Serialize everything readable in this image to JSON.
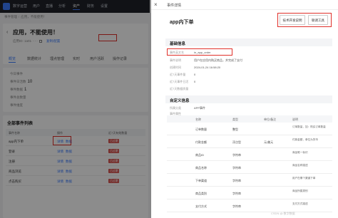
{
  "nav": {
    "items": [
      "数字运营",
      "用户",
      "直播",
      "分析",
      "资产",
      "财务",
      "设置"
    ],
    "active_index": 4
  },
  "breadcrumb": {
    "parent": "事件管理",
    "current": "应用，不能使用！"
  },
  "header": {
    "title": "应用，不能使用！",
    "id_label": "应用ID: 1a01······",
    "id_link": "复制/配置",
    "tabs": [
      "概览",
      "数据统计",
      "埋点管理",
      "实时",
      "用户活跃",
      "操作记录"
    ],
    "active_tab": 0
  },
  "stats": [
    {
      "label": "今日事件",
      "value": ""
    },
    {
      "label": "事件日活数",
      "value": "10"
    },
    {
      "label": "事件数据",
      "value": "1"
    },
    {
      "label": "事件总数量",
      "value": ""
    },
    {
      "label": "事件维度",
      "value": ""
    }
  ],
  "event_list": {
    "title": "全部事件列表",
    "columns": [
      "事件名称",
      "操作",
      "近7天有效数量"
    ],
    "rows": [
      {
        "name": "app内下单",
        "actions": [
          "详情",
          "数据"
        ],
        "badge": "已过期"
      },
      {
        "name": "登录",
        "actions": [
          "详情",
          "数据"
        ],
        "badge": "已过期"
      },
      {
        "name": "注册",
        "actions": [
          "详情",
          "数据"
        ],
        "badge": "已过期"
      },
      {
        "name": "商品浏览",
        "actions": [
          "详情",
          "数据"
        ],
        "badge": "已过期"
      },
      {
        "name": "点击购买",
        "actions": [
          "详情",
          "数据"
        ],
        "badge": "已过期"
      }
    ]
  },
  "drawer": {
    "close": "×",
    "title": "事件详情",
    "event_name": "app内下单",
    "buttons": {
      "dev_doc": "技术开发说明",
      "test_tool": "联调工具"
    },
    "basic_section": "基础信息",
    "basic_fields": [
      {
        "label": "事件英文名",
        "value": "in_app_order"
      },
      {
        "label": "事件说明",
        "value": "用户在应用内购买商品，并完成了支付"
      },
      {
        "label": "创建时间",
        "value": "2024-01-24 16:58:20"
      },
      {
        "label": "近7天事件量",
        "value": "0"
      },
      {
        "label": "近7天事件日活",
        "value": "0"
      },
      {
        "label": "近7天数据质量",
        "value": ""
      }
    ],
    "custom_section": "自定义信息",
    "custom_fields": [
      {
        "label": "所属分类",
        "value": "APP事件"
      },
      {
        "label": "事件属性",
        "value": ""
      }
    ],
    "table": {
      "columns": [
        "名称",
        "类型",
        "单位/备注",
        "说明"
      ],
      "rows": [
        {
          "name": "订单数量",
          "type": "整型",
          "unit": "",
          "desc": "订单数量，如：购买订单数量"
        },
        {
          "name": "付款金额",
          "type": "浮点型",
          "unit": "元/美元",
          "desc": "付款金额，单位为货币"
        },
        {
          "name": "商品ID",
          "type": "字符串",
          "unit": "",
          "desc": "商品唯一标识"
        },
        {
          "name": "商品名称",
          "type": "字符串",
          "unit": "",
          "desc": "商品名称描述"
        },
        {
          "name": "下单渠道",
          "type": "字符串",
          "unit": "",
          "desc": "用户在哪个渠道下单"
        },
        {
          "name": "商品类别",
          "type": "字符串",
          "unit": "",
          "desc": "商品所属类别"
        },
        {
          "name": "支付方式",
          "type": "字符串",
          "unit": "",
          "desc": "支付方式描述"
        }
      ]
    }
  },
  "watermark": "CSDN @ 数字数据"
}
